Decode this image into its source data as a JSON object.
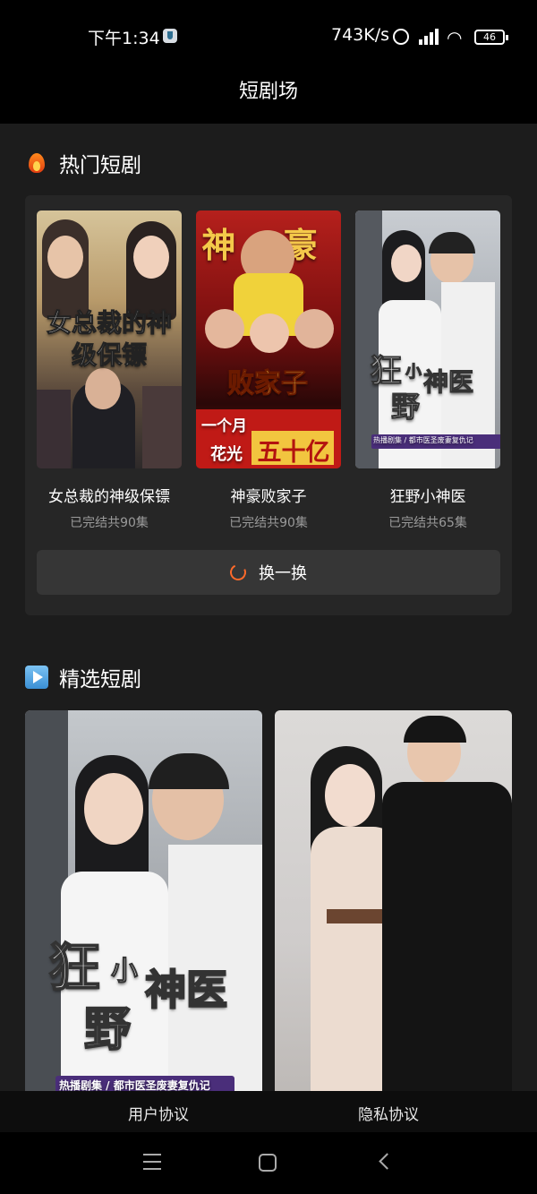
{
  "status_bar": {
    "time": "下午1:34",
    "net_speed": "743K/s",
    "battery": "46"
  },
  "header": {
    "title": "短剧场"
  },
  "hot_section": {
    "title": "热门短剧",
    "icon": "fire-icon",
    "dramas": [
      {
        "poster_text": "女总裁的神级保镖",
        "title": "女总裁的神级保镖",
        "status": "已完结共90集"
      },
      {
        "poster_text_top": "神 豪",
        "poster_text_mid": "败家子",
        "poster_text_line": "一个月",
        "poster_text_small": "花光",
        "poster_text_big": "五十亿",
        "title": "神豪败家子",
        "status": "已完结共90集"
      },
      {
        "poster_text_a": "狂",
        "poster_text_b": "小",
        "poster_text_c": "神医",
        "poster_text_d": "野",
        "poster_tag": "热播剧集 / 都市医圣废妻复仇记",
        "title": "狂野小神医",
        "status": "已完结共65集"
      }
    ],
    "refresh_label": "换一换",
    "refresh_icon": "refresh-icon"
  },
  "selected_section": {
    "title": "精选短剧",
    "icon": "play-icon",
    "cards": [
      {
        "poster_text_a": "狂",
        "poster_text_b": "小",
        "poster_text_c": "神医",
        "poster_text_d": "野",
        "poster_tag": "热播剧集 / 都市医圣废妻复仇记"
      },
      {}
    ]
  },
  "footer": {
    "user_agreement": "用户协议",
    "privacy_policy": "隐私协议"
  },
  "colors": {
    "accent": "#ff6a2a",
    "panel": "#262626",
    "background": "#1c1c1c"
  }
}
